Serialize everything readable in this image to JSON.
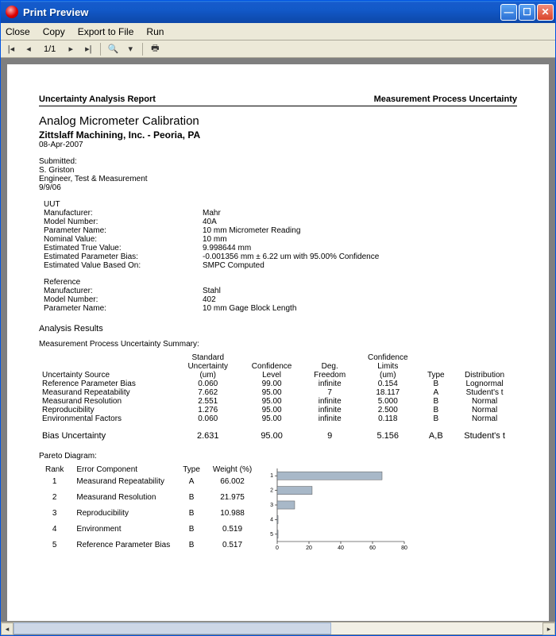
{
  "window": {
    "title": "Print Preview"
  },
  "menu": {
    "close": "Close",
    "copy": "Copy",
    "export": "Export to File",
    "run": "Run"
  },
  "toolbar": {
    "page_indicator": "1/1"
  },
  "report": {
    "header_left": "Uncertainty Analysis Report",
    "header_right": "Measurement Process Uncertainty",
    "title": "Analog Micrometer Calibration",
    "company": "Zittslaff Machining, Inc. - Peoria, PA",
    "date": "08-Apr-2007",
    "submitted_label": "Submitted:",
    "submitted_name": "S. Griston",
    "submitted_role": "Engineer, Test & Measurement",
    "submitted_date": "9/9/06"
  },
  "uut": {
    "section": "UUT",
    "rows": [
      {
        "k": "Manufacturer:",
        "v": "Mahr"
      },
      {
        "k": "Model Number:",
        "v": "40A"
      },
      {
        "k": "Parameter Name:",
        "v": "10 mm Micrometer Reading"
      },
      {
        "k": "Nominal Value:",
        "v": "10 mm"
      },
      {
        "k": "Estimated True Value:",
        "v": "9.998644 mm"
      },
      {
        "k": "Estimated Parameter Bias:",
        "v": "-0.001356 mm ± 6.22 um with 95.00% Confidence"
      },
      {
        "k": "Estimated Value Based On:",
        "v": "SMPC Computed"
      }
    ]
  },
  "reference": {
    "section": "Reference",
    "rows": [
      {
        "k": "Manufacturer:",
        "v": "Stahl"
      },
      {
        "k": "Model Number:",
        "v": "402"
      },
      {
        "k": "Parameter Name:",
        "v": "10 mm Gage Block Length"
      }
    ]
  },
  "analysis": {
    "title": "Analysis Results",
    "summary_title": "Measurement Process Uncertainty Summary:",
    "cols": {
      "src": "Uncertainty Source",
      "su1": "Standard",
      "su2": "Uncertainty",
      "su3": "(um)",
      "cl1": "Confidence",
      "cl2": "Level",
      "df1": "Deg.",
      "df2": "Freedom",
      "lim1": "Confidence",
      "lim2": "Limits",
      "lim3": "(um)",
      "type": "Type",
      "dist": "Distribution"
    },
    "rows": [
      {
        "src": "Reference Parameter Bias",
        "su": "0.060",
        "cl": "99.00",
        "df": "infinite",
        "lim": "0.154",
        "type": "B",
        "dist": "Lognormal"
      },
      {
        "src": "Measurand Repeatability",
        "su": "7.662",
        "cl": "95.00",
        "df": "7",
        "lim": "18.117",
        "type": "A",
        "dist": "Student's t"
      },
      {
        "src": "Measurand Resolution",
        "su": "2.551",
        "cl": "95.00",
        "df": "infinite",
        "lim": "5.000",
        "type": "B",
        "dist": "Normal"
      },
      {
        "src": "Reproducibility",
        "su": "1.276",
        "cl": "95.00",
        "df": "infinite",
        "lim": "2.500",
        "type": "B",
        "dist": "Normal"
      },
      {
        "src": "Environmental Factors",
        "su": "0.060",
        "cl": "95.00",
        "df": "infinite",
        "lim": "0.118",
        "type": "B",
        "dist": "Normal"
      }
    ],
    "footer": {
      "label": "Bias Uncertainty",
      "su": "2.631",
      "cl": "95.00",
      "df": "9",
      "lim": "5.156",
      "type": "A,B",
      "dist": "Student's t"
    }
  },
  "pareto": {
    "title": "Pareto Diagram:",
    "cols": {
      "rank": "Rank",
      "err": "Error Component",
      "type": "Type",
      "wt": "Weight (%)"
    },
    "rows": [
      {
        "rank": "1",
        "err": "Measurand Repeatability",
        "type": "A",
        "wt": "66.002"
      },
      {
        "rank": "2",
        "err": "Measurand Resolution",
        "type": "B",
        "wt": "21.975"
      },
      {
        "rank": "3",
        "err": "Reproducibility",
        "type": "B",
        "wt": "10.988"
      },
      {
        "rank": "4",
        "err": "Environment",
        "type": "B",
        "wt": "0.519"
      },
      {
        "rank": "5",
        "err": "Reference Parameter Bias",
        "type": "B",
        "wt": "0.517"
      }
    ]
  },
  "chart_data": {
    "type": "bar",
    "orientation": "horizontal",
    "categories": [
      "1",
      "2",
      "3",
      "4",
      "5"
    ],
    "values": [
      66.002,
      21.975,
      10.988,
      0.519,
      0.517
    ],
    "xlabel": "",
    "ylabel": "",
    "xlim": [
      0,
      80
    ],
    "xticks": [
      0,
      20,
      40,
      60,
      80
    ],
    "bar_color": "#a8b8c8"
  }
}
